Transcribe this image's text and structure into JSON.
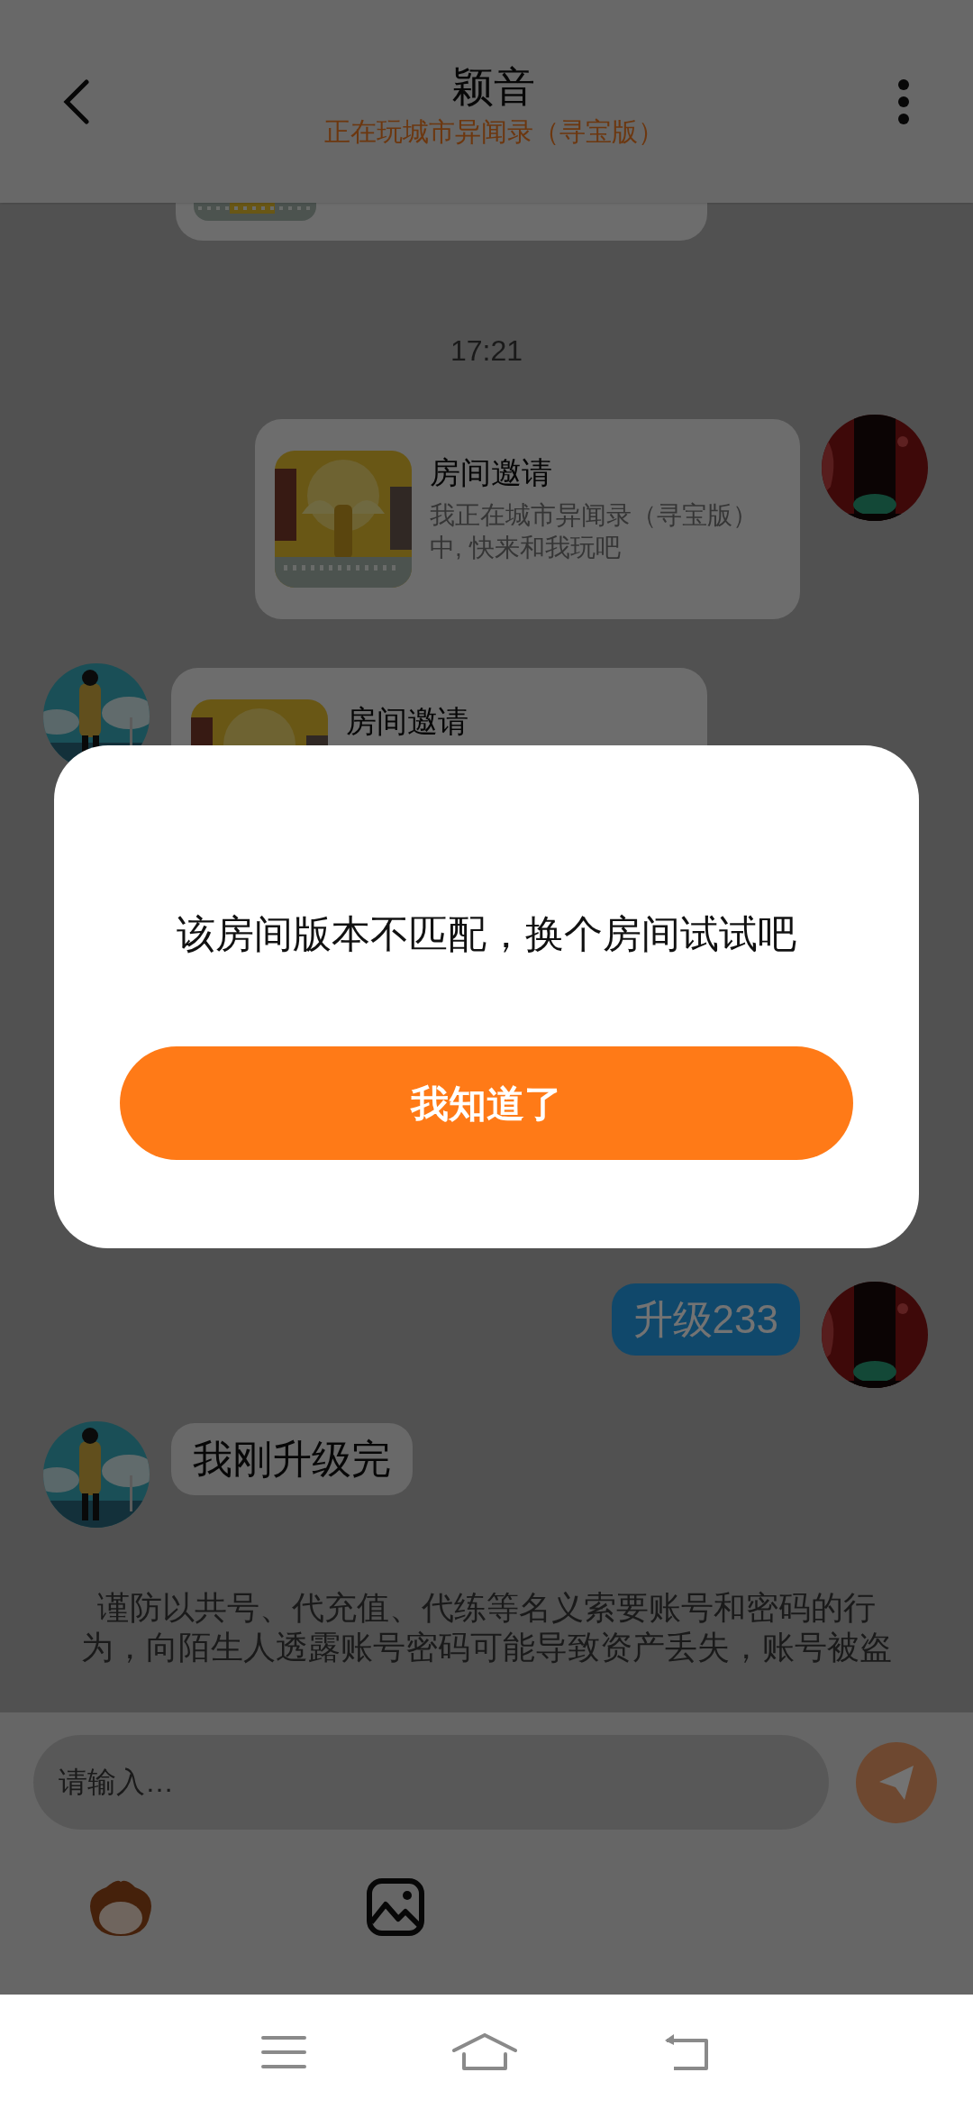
{
  "header": {
    "title": "颖音",
    "status": "正在玩城市异闻录（寻宝版）"
  },
  "messages": [
    {
      "kind": "partial_card"
    },
    {
      "kind": "time",
      "text": "17:21"
    },
    {
      "kind": "invite",
      "outgoing": true,
      "title": "房间邀请",
      "text": "我正在城市异闻录（寻宝版）中, 快来和我玩吧"
    },
    {
      "kind": "invite",
      "outgoing": false,
      "title": "房间邀请"
    }
  ],
  "latest_messages": [
    {
      "kind": "text",
      "outgoing": true,
      "text": "升级233"
    },
    {
      "kind": "text",
      "outgoing": false,
      "text": "我刚升级完"
    },
    {
      "kind": "notice",
      "text": "谨防以共号、代充值、代练等名义索要账号和密码的行为，向陌生人透露账号密码可能导致资产丢失，账号被盗"
    }
  ],
  "composer": {
    "placeholder": "请输入…"
  },
  "dialog": {
    "message": "该房间版本不匹配，换个房间试试吧",
    "button": "我知道了"
  }
}
